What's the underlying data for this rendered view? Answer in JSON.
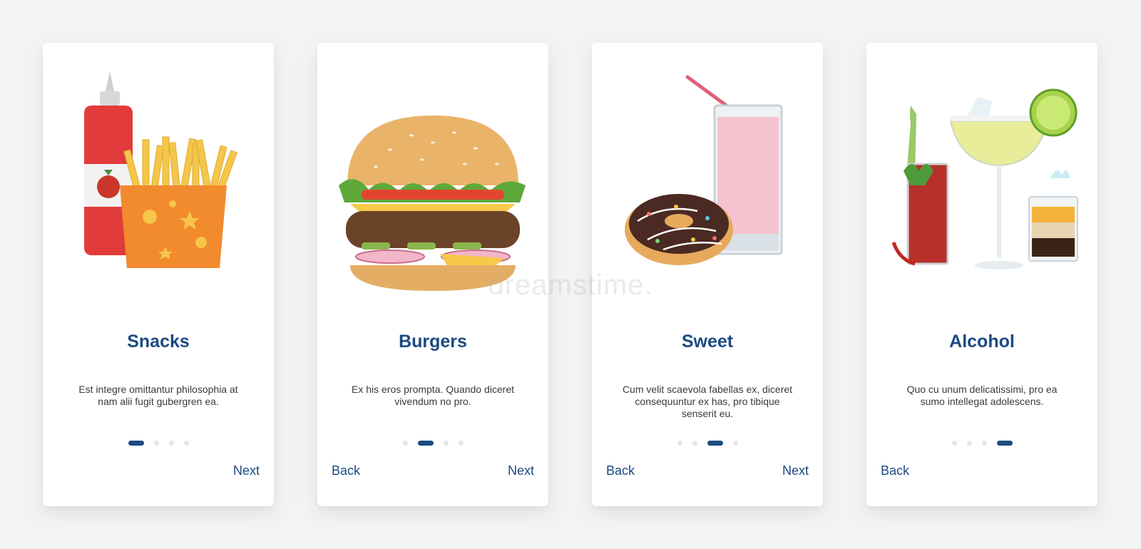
{
  "cards": [
    {
      "title": "Snacks",
      "description": "Est integre omittantur philosophia at nam alii fugit gubergren ea.",
      "back_label": "",
      "next_label": "Next",
      "active_page": 1,
      "illustration": "ketchup-fries-icon"
    },
    {
      "title": "Burgers",
      "description": "Ex his eros prompta. Quando diceret vivendum no pro.",
      "back_label": "Back",
      "next_label": "Next",
      "active_page": 2,
      "illustration": "burger-icon"
    },
    {
      "title": "Sweet",
      "description": "Cum velit scaevola fabellas ex, diceret consequuntur ex has, pro tibique senserit eu.",
      "back_label": "Back",
      "next_label": "Next",
      "active_page": 3,
      "illustration": "donut-milkshake-icon"
    },
    {
      "title": "Alcohol",
      "description": "Quo cu unum delicatissimi, pro ea sumo intellegat adolescens.",
      "back_label": "Back",
      "next_label": "",
      "active_page": 4,
      "illustration": "cocktails-icon"
    }
  ],
  "pagination": {
    "total_pages": 4
  },
  "watermark": "dreamstime.",
  "colors": {
    "accent": "#1c4a82",
    "background": "#f3f3f4",
    "card": "#ffffff",
    "inactive_dot": "#e6e6e8",
    "text": "#3a3a3a"
  }
}
